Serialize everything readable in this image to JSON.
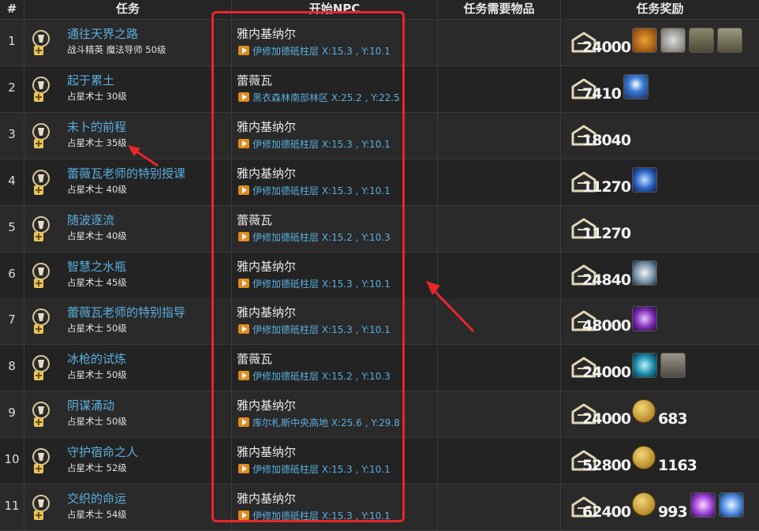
{
  "headers": {
    "num": "#",
    "quest": "任务",
    "npc": "开始NPC",
    "items": "任务需要物品",
    "reward": "任务奖励"
  },
  "rows": [
    {
      "num": "1",
      "title": "通往天界之路",
      "sub": "战斗精英 魔法导师 50级",
      "npc": "雅内基纳尔",
      "loc": "伊修加德砥柱层 X:15.3 , Y:10.1",
      "gil": "24000",
      "items": [
        "orange-badge",
        "silver-gear",
        "coat",
        "pants"
      ],
      "coin": null
    },
    {
      "num": "2",
      "title": "起于累土",
      "sub": "占星术士 30级",
      "npc": "蕾薇瓦",
      "loc": "黑衣森林南部林区 X:25.2 , Y:22.5",
      "gil": "7410",
      "items": [
        "blue-spell"
      ],
      "coin": null
    },
    {
      "num": "3",
      "title": "未卜的前程",
      "sub": "占星术士 35级",
      "npc": "雅内基纳尔",
      "loc": "伊修加德砥柱层 X:15.3 , Y:10.1",
      "gil": "18040",
      "items": [],
      "coin": null
    },
    {
      "num": "4",
      "title": "蕾薇瓦老师的特别授课",
      "sub": "占星术士 40级",
      "npc": "雅内基纳尔",
      "loc": "伊修加德砥柱层 X:15.3 , Y:10.1",
      "gil": "11270",
      "items": [
        "clock-spell"
      ],
      "coin": null
    },
    {
      "num": "5",
      "title": "随波逐流",
      "sub": "占星术士 40级",
      "npc": "蕾薇瓦",
      "loc": "伊修加德砥柱层 X:15.2 , Y:10.3",
      "gil": "11270",
      "items": [],
      "coin": null
    },
    {
      "num": "6",
      "title": "智慧之水瓶",
      "sub": "占星术士 45级",
      "npc": "雅内基纳尔",
      "loc": "伊修加德砥柱层 X:15.3 , Y:10.1",
      "gil": "24840",
      "items": [
        "orb-spell"
      ],
      "coin": null
    },
    {
      "num": "7",
      "title": "蕾薇瓦老师的特别指导",
      "sub": "占星术士 50级",
      "npc": "雅内基纳尔",
      "loc": "伊修加德砥柱层 X:15.3 , Y:10.1",
      "gil": "48000",
      "items": [
        "purple-spell"
      ],
      "coin": null
    },
    {
      "num": "8",
      "title": "冰枪的试炼",
      "sub": "占星术士 50级",
      "npc": "蕾薇瓦",
      "loc": "伊修加德砥柱层 X:15.2 , Y:10.3",
      "gil": "24000",
      "items": [
        "teal-spell",
        "grey-item"
      ],
      "coin": null
    },
    {
      "num": "9",
      "title": "阴谋涌动",
      "sub": "占星术士 50级",
      "npc": "雅内基纳尔",
      "loc": "库尔札斯中央高地 X:25.6 , Y:29.8",
      "gil": "24000",
      "items": [],
      "coin": "683"
    },
    {
      "num": "10",
      "title": "守护宿命之人",
      "sub": "占星术士 52级",
      "npc": "雅内基纳尔",
      "loc": "伊修加德砥柱层 X:15.3 , Y:10.1",
      "gil": "52800",
      "items": [],
      "coin": "1163"
    },
    {
      "num": "11",
      "title": "交织的命运",
      "sub": "占星术士 54级",
      "npc": "雅内基纳尔",
      "loc": "伊修加德砥柱层 X:15.3 , Y:10.1",
      "gil": "62400",
      "items": [
        "violet-spell",
        "star-spell"
      ],
      "coin": "993"
    }
  ],
  "colors": {
    "link": "#5aaede",
    "highlight": "#e8262a",
    "location_icon": "#e08b1b"
  }
}
